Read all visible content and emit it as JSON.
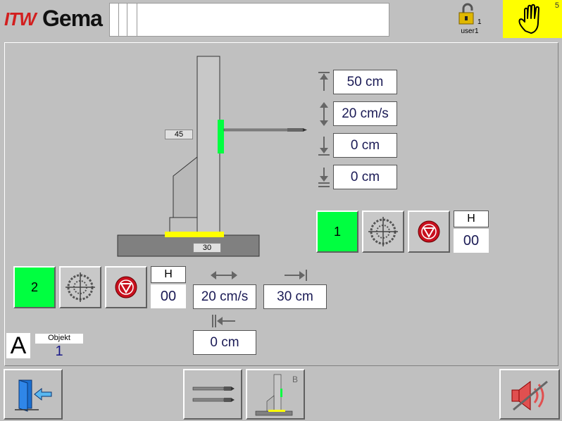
{
  "header": {
    "logo_itw": "ITW",
    "logo_gema": "Gema",
    "user_name": "user1",
    "user_level": "1",
    "alarm_count": "5"
  },
  "vertical_axis": {
    "stroke_upper": "50 cm",
    "speed": "20 cm/s",
    "lower_position": "0 cm",
    "park_position": "0 cm",
    "unit_label": "1",
    "h_label": "H",
    "h_value": "00",
    "gauge_value": "45"
  },
  "horizontal_axis": {
    "unit_label": "2",
    "h_label": "H",
    "h_value": "00",
    "speed": "20 cm/s",
    "stroke": "30 cm",
    "retract": "0 cm",
    "gauge_value": "30"
  },
  "object": {
    "mode": "A",
    "label": "Objekt",
    "value": "1"
  },
  "footer": {
    "axis_button_letter": "B"
  },
  "colors": {
    "active_green": "#00ff40",
    "warning_yellow": "#ffff00",
    "stop_red": "#c8101e"
  }
}
